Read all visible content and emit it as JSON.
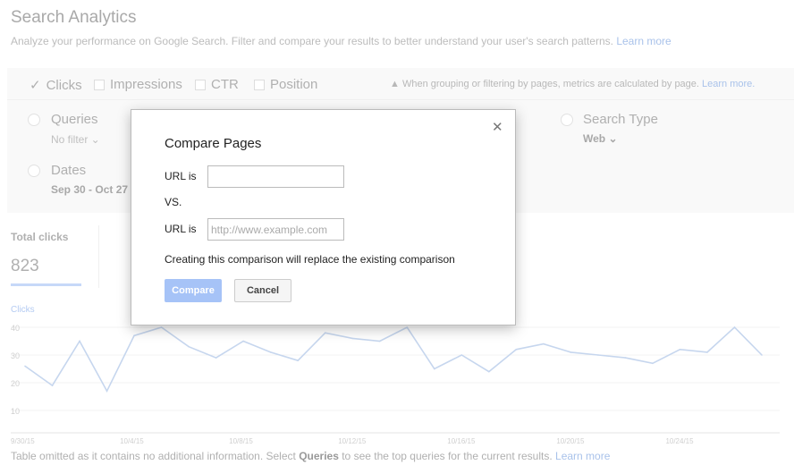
{
  "page": {
    "title": "Search Analytics",
    "subtitle": "Analyze your performance on Google Search. Filter and compare your results to better understand your user's search patterns.",
    "subtitle_link": "Learn more"
  },
  "metrics": [
    {
      "label": "Clicks",
      "checked": true
    },
    {
      "label": "Impressions",
      "checked": false
    },
    {
      "label": "CTR",
      "checked": false
    },
    {
      "label": "Position",
      "checked": false
    }
  ],
  "warning": {
    "text": "When grouping or filtering by pages, metrics are calculated by page.",
    "link": "Learn more."
  },
  "filters": {
    "queries": {
      "label": "Queries",
      "value": "No filter ⌄"
    },
    "dates": {
      "label": "Dates",
      "value": "Sep 30 - Oct 27"
    },
    "search_type": {
      "label": "Search Type",
      "value": "Web ⌄"
    }
  },
  "summary": {
    "label": "Total clicks",
    "value": "823"
  },
  "chart_data": {
    "type": "line",
    "ylabel": "Clicks",
    "ylim": [
      0,
      40
    ],
    "yticks": [
      "40",
      "30",
      "20",
      "10"
    ],
    "xtick_labels": [
      "9/30/15",
      "10/4/15",
      "10/8/15",
      "10/12/15",
      "10/16/15",
      "10/20/15",
      "10/24/15"
    ],
    "x": [
      "9/30/15",
      "10/1/15",
      "10/2/15",
      "10/3/15",
      "10/4/15",
      "10/5/15",
      "10/6/15",
      "10/7/15",
      "10/8/15",
      "10/9/15",
      "10/10/15",
      "10/11/15",
      "10/12/15",
      "10/13/15",
      "10/14/15",
      "10/15/15",
      "10/16/15",
      "10/17/15",
      "10/18/15",
      "10/19/15",
      "10/20/15",
      "10/21/15",
      "10/22/15",
      "10/23/15",
      "10/24/15",
      "10/25/15",
      "10/26/15",
      "10/27/15"
    ],
    "values": [
      26,
      19,
      35,
      17,
      37,
      40,
      33,
      29,
      35,
      31,
      28,
      38,
      36,
      35,
      40,
      25,
      30,
      24,
      32,
      34,
      31,
      30,
      29,
      27,
      32,
      31,
      40,
      30
    ],
    "grid": true,
    "color": "#4d90fe"
  },
  "footer": {
    "pre": "Table omitted as it contains no additional information. Select ",
    "bold": "Queries",
    "post": " to see the top queries for the current results.",
    "link": "Learn more"
  },
  "dialog": {
    "title": "Compare Pages",
    "url_label_1": "URL is",
    "url_value_1": "",
    "vs": "VS.",
    "url_label_2": "URL is",
    "url_placeholder_2": "http://www.example.com",
    "notice": "Creating this comparison will replace the existing comparison",
    "compare": "Compare",
    "cancel": "Cancel",
    "close": "✕"
  }
}
